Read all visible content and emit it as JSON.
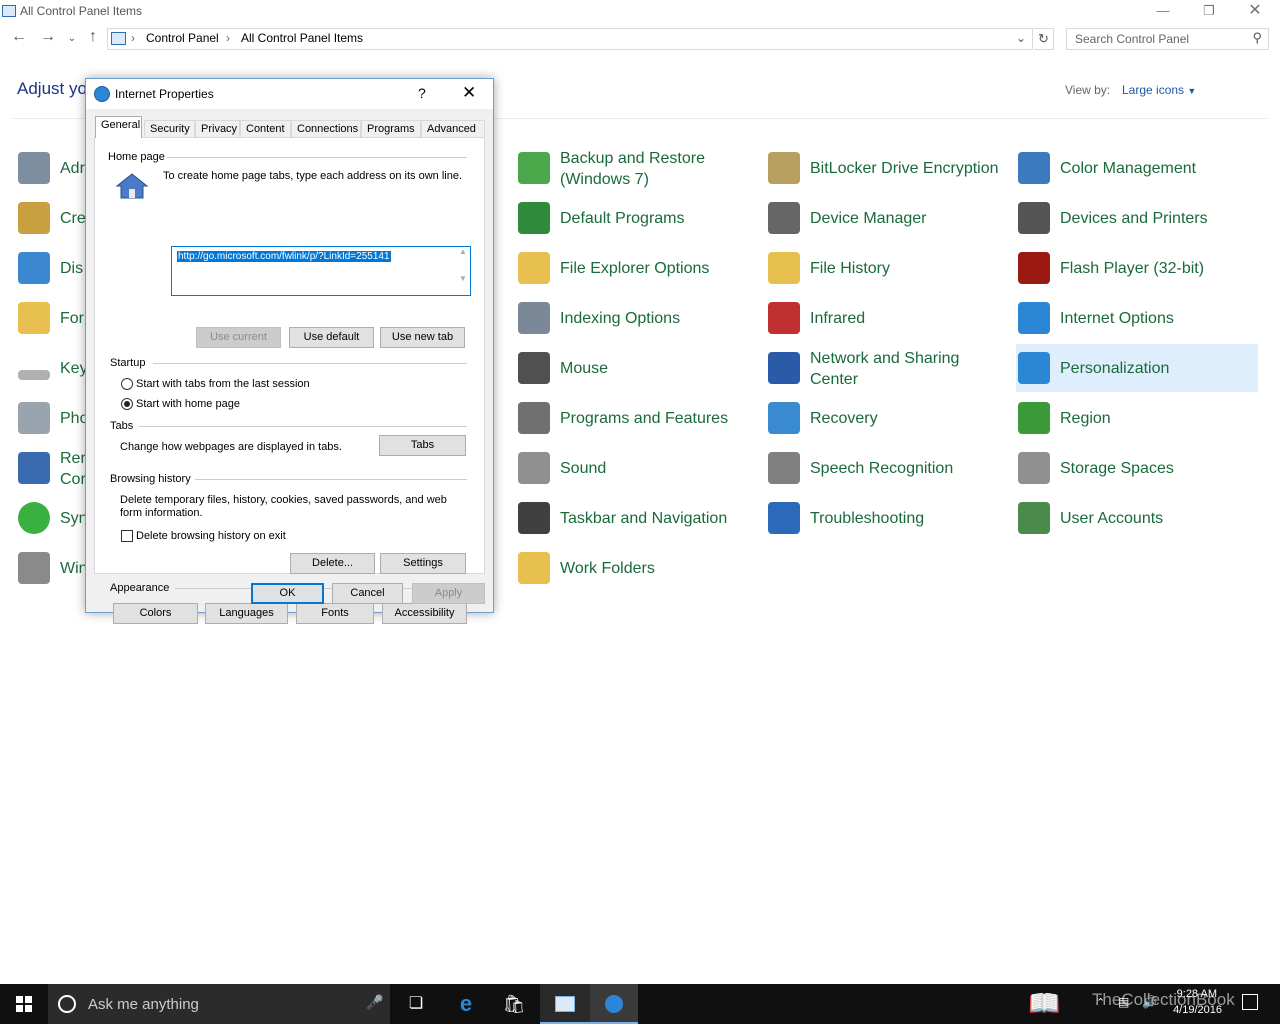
{
  "window": {
    "title": "All Control Panel Items"
  },
  "breadcrumb": {
    "items": [
      "Control Panel",
      "All Control Panel Items"
    ]
  },
  "search": {
    "placeholder": "Search Control Panel"
  },
  "header": {
    "adjust_text": "Adjust you",
    "view_by_label": "View by:",
    "view_by_value": "Large icons"
  },
  "left_items": [
    "Adr",
    "Cre",
    "Dis",
    "For",
    "Key",
    "Pho",
    "Rer\nCor",
    "Syn",
    "Win"
  ],
  "items": [
    {
      "label": "Backup and Restore\n(Windows 7)",
      "icon": "backup-icon",
      "color": "#4aa84a"
    },
    {
      "label": "BitLocker Drive Encryption",
      "icon": "bitlocker-icon",
      "color": "#b8a060"
    },
    {
      "label": "Color Management",
      "icon": "color-management-icon",
      "color": "#3c7ac0"
    },
    {
      "label": "Default Programs",
      "icon": "default-programs-icon",
      "color": "#2e8b3a"
    },
    {
      "label": "Device Manager",
      "icon": "device-manager-icon",
      "color": "#666666"
    },
    {
      "label": "Devices and Printers",
      "icon": "printer-icon",
      "color": "#555555"
    },
    {
      "label": "File Explorer Options",
      "icon": "folder-options-icon",
      "color": "#e8c050"
    },
    {
      "label": "File History",
      "icon": "file-history-icon",
      "color": "#e8c050"
    },
    {
      "label": "Flash Player (32-bit)",
      "icon": "flash-icon",
      "color": "#9a1a12"
    },
    {
      "label": "Indexing Options",
      "icon": "indexing-icon",
      "color": "#7a8898"
    },
    {
      "label": "Infrared",
      "icon": "infrared-icon",
      "color": "#c03030"
    },
    {
      "label": "Internet Options",
      "icon": "internet-options-icon",
      "color": "#2b86d6"
    },
    {
      "label": "Mouse",
      "icon": "mouse-icon",
      "color": "#505050"
    },
    {
      "label": "Network and Sharing\nCenter",
      "icon": "network-icon",
      "color": "#2b5aa8"
    },
    {
      "label": "Personalization",
      "icon": "personalization-icon",
      "color": "#2b86d6"
    },
    {
      "label": "Programs and Features",
      "icon": "programs-features-icon",
      "color": "#707070"
    },
    {
      "label": "Recovery",
      "icon": "recovery-icon",
      "color": "#3a8ad0"
    },
    {
      "label": "Region",
      "icon": "region-icon",
      "color": "#3a9a3a"
    },
    {
      "label": "Sound",
      "icon": "sound-icon",
      "color": "#909090"
    },
    {
      "label": "Speech Recognition",
      "icon": "microphone-icon",
      "color": "#808080"
    },
    {
      "label": "Storage Spaces",
      "icon": "storage-icon",
      "color": "#909090"
    },
    {
      "label": "Taskbar and Navigation",
      "icon": "taskbar-icon",
      "color": "#404040"
    },
    {
      "label": "Troubleshooting",
      "icon": "troubleshooting-icon",
      "color": "#2b6ab8"
    },
    {
      "label": "User Accounts",
      "icon": "user-accounts-icon",
      "color": "#4a8a4a"
    },
    {
      "label": "Work Folders",
      "icon": "work-folders-icon",
      "color": "#e8c050"
    }
  ],
  "dialog": {
    "title": "Internet Properties",
    "help": "?",
    "tabs": [
      "General",
      "Security",
      "Privacy",
      "Content",
      "Connections",
      "Programs",
      "Advanced"
    ],
    "home_page": {
      "heading": "Home page",
      "description": "To create home page tabs, type each address on its own line.",
      "url": "http://go.microsoft.com/fwlink/p/?LinkId=255141",
      "use_current": "Use current",
      "use_default": "Use default",
      "use_new_tab": "Use new tab"
    },
    "startup": {
      "heading": "Startup",
      "option1": "Start with tabs from the last session",
      "option2": "Start with home page"
    },
    "tabs_section": {
      "heading": "Tabs",
      "description": "Change how webpages are displayed in tabs.",
      "button": "Tabs"
    },
    "browsing": {
      "heading": "Browsing history",
      "description": "Delete temporary files, history, cookies, saved passwords, and web form information.",
      "checkbox": "Delete browsing history on exit",
      "delete": "Delete...",
      "settings": "Settings"
    },
    "appearance": {
      "heading": "Appearance",
      "colors": "Colors",
      "languages": "Languages",
      "fonts": "Fonts",
      "accessibility": "Accessibility"
    },
    "ok": "OK",
    "cancel": "Cancel",
    "apply": "Apply"
  },
  "taskbar": {
    "search_placeholder": "Ask me anything",
    "time": "9:28 AM",
    "date": "4/19/2016",
    "watermark": "TheCollectionBook"
  }
}
